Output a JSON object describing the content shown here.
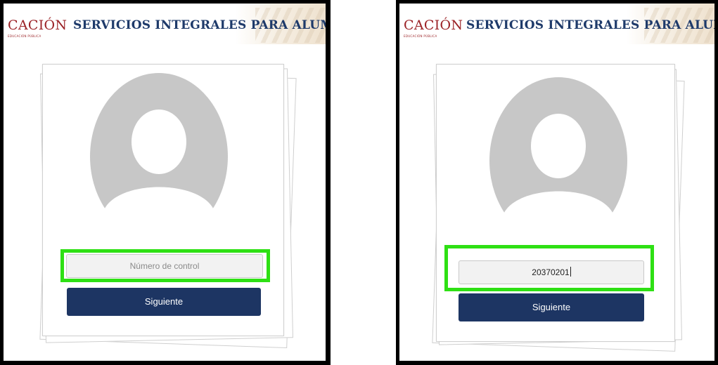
{
  "header": {
    "brand": "CACIÓN",
    "brand_sub": "EDUCACIÓN PÚBLICA",
    "title": "SERVICIOS INTEGRALES PARA ALUMNOS"
  },
  "left_panel": {
    "control_field": {
      "value": "",
      "placeholder": "Número de control"
    },
    "next_button_label": "Siguiente"
  },
  "right_panel": {
    "control_field": {
      "value": "20370201",
      "placeholder": "Número de control"
    },
    "next_button_label": "Siguiente"
  },
  "colors": {
    "brand": "#9b2226",
    "title": "#1e3a6a",
    "button": "#1d3563",
    "highlight": "#2ee014",
    "avatar": "#c7c7c7"
  },
  "icons": {
    "avatar": "user-silhouette-icon"
  }
}
